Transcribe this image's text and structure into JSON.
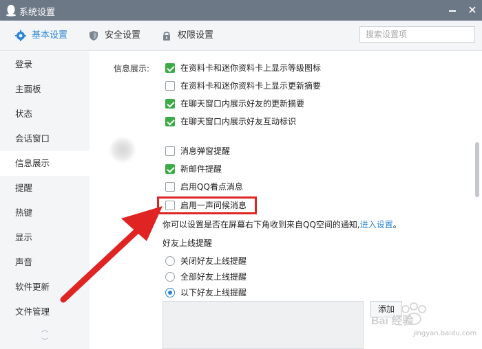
{
  "window": {
    "title": "系统设置",
    "close_glyph": "✕"
  },
  "tabs": [
    {
      "label": "基本设置",
      "icon": "gear-icon"
    },
    {
      "label": "安全设置",
      "icon": "shield-icon"
    },
    {
      "label": "权限设置",
      "icon": "lock-icon"
    }
  ],
  "search": {
    "placeholder": "搜索设置项",
    "value": ""
  },
  "sidebar": {
    "items": [
      {
        "label": "登录"
      },
      {
        "label": "主面板"
      },
      {
        "label": "状态"
      },
      {
        "label": "会话窗口"
      },
      {
        "label": "信息展示"
      },
      {
        "label": "提醒"
      },
      {
        "label": "热键"
      },
      {
        "label": "显示"
      },
      {
        "label": "声音"
      },
      {
        "label": "软件更新"
      },
      {
        "label": "文件管理"
      }
    ],
    "active": "信息展示",
    "scroll_up": "︿",
    "scroll_down": "﹀"
  },
  "info_display": {
    "label": "信息展示:",
    "options": [
      {
        "text": "在资料卡和迷你资料卡上显示等级图标",
        "checked": true
      },
      {
        "text": "在资料卡和迷你资料卡上显示更新摘要",
        "checked": false
      },
      {
        "text": "在聊天窗口内展示好友的更新摘要",
        "checked": true
      },
      {
        "text": "在聊天窗口内展示好友互动标识",
        "checked": true
      }
    ]
  },
  "reminders": {
    "options": [
      {
        "text": "消息弹窗提醒",
        "checked": false
      },
      {
        "text": "新邮件提醒",
        "checked": true
      },
      {
        "text": "启用QQ看点消息",
        "checked": false
      },
      {
        "text": "启用一声问候消息",
        "checked": false
      }
    ],
    "hint_text": "你可以设置是否在屏幕右下角收到来自QQ空间的通知,",
    "hint_link": "进入设置",
    "hint_end": "。"
  },
  "friend_online": {
    "title": "好友上线提醒",
    "options": [
      {
        "text": "关闭好友上线提醒",
        "selected": false
      },
      {
        "text": "全部好友上线提醒",
        "selected": false
      },
      {
        "text": "以下好友上线提醒",
        "selected": true
      }
    ],
    "add_label": "添加"
  },
  "watermark": {
    "text": "jingyan.baidu.com",
    "brand": "Bai 经验"
  },
  "colors": {
    "accent": "#2b86d6",
    "checked": "#3cab47",
    "annotation": "#e02424",
    "titlebar": "#6d7886"
  }
}
